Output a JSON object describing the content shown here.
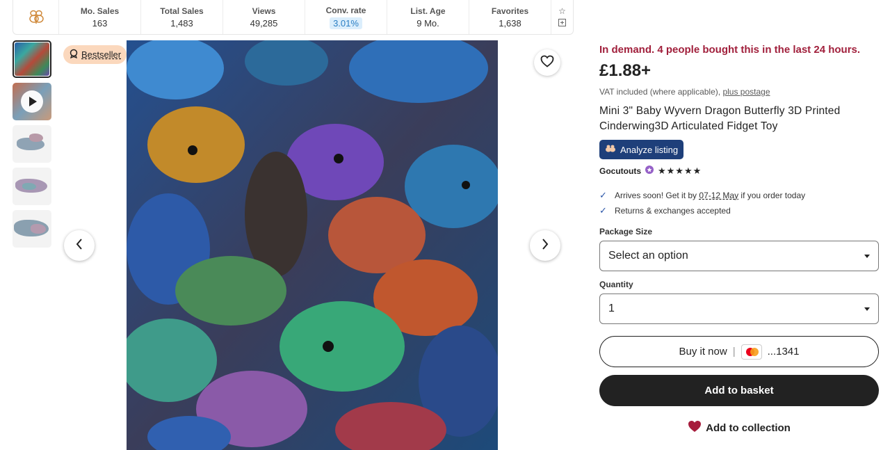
{
  "stats": {
    "items": [
      {
        "label": "Mo. Sales",
        "value": "163"
      },
      {
        "label": "Total Sales",
        "value": "1,483"
      },
      {
        "label": "Views",
        "value": "49,285"
      },
      {
        "label": "Conv. rate",
        "value": "3.01%"
      },
      {
        "label": "List. Age",
        "value": "9 Mo."
      },
      {
        "label": "Favorites",
        "value": "1,638"
      }
    ],
    "action_icons": [
      "star-icon",
      "expand-icon"
    ],
    "logo_icon": "bee-logo-icon"
  },
  "gallery": {
    "badge_label": "Bestseller",
    "badge_icon": "medal-icon",
    "favorite_icon": "heart-outline-icon",
    "prev_icon": "chevron-left-icon",
    "next_icon": "chevron-right-icon",
    "thumbnail_count": 5,
    "video_thumbnail_icon": "play-icon"
  },
  "product": {
    "demand_text": "In demand. 4 people bought this in the last 24 hours.",
    "price": "£1.88+",
    "vat_text": "VAT included (where applicable), ",
    "vat_link": "plus postage",
    "title": "Mini 3\" Baby Wyvern Dragon Butterfly 3D Printed Cinderwing3D Articulated Fidget Toy",
    "analyze_label": "Analyze listing",
    "shop_name": "Gocutouts",
    "star_icon": "star-seller-badge-icon",
    "rating_stars": "★★★★★",
    "arrives_prefix": "Arrives soon! Get it by ",
    "arrives_dates": "07-12 May",
    "arrives_suffix": " if you order today",
    "returns_text": "Returns & exchanges accepted",
    "package_label": "Package Size",
    "package_value": "Select an option",
    "quantity_label": "Quantity",
    "quantity_value": "1",
    "buy_now_label": "Buy it now",
    "card_digits": "...1341",
    "add_basket_label": "Add to basket",
    "add_collection_label": "Add to collection"
  },
  "colors": {
    "demand": "#a1203c",
    "analyze_bg": "#1e3f7a",
    "badge_bg": "#fbd8bd",
    "primary_button": "#222222"
  }
}
